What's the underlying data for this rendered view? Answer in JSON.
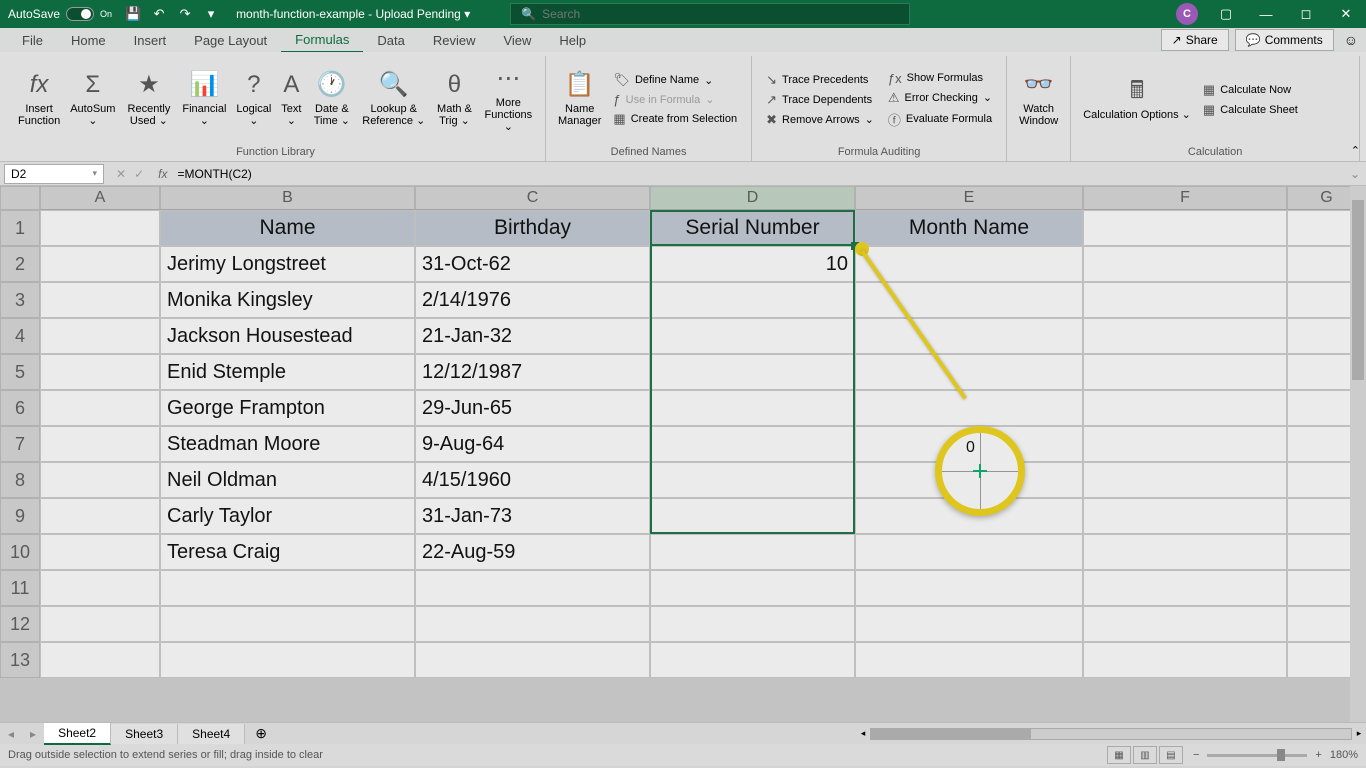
{
  "titlebar": {
    "autosave_label": "AutoSave",
    "autosave_state": "On",
    "filename": "month-function-example - Upload Pending",
    "search_placeholder": "Search",
    "avatar_initial": "C"
  },
  "tabs": {
    "file": "File",
    "home": "Home",
    "insert": "Insert",
    "pagelayout": "Page Layout",
    "formulas": "Formulas",
    "data": "Data",
    "review": "Review",
    "view": "View",
    "help": "Help",
    "share": "Share",
    "comments": "Comments"
  },
  "ribbon": {
    "insert_function": "Insert\nFunction",
    "autosum": "AutoSum",
    "recently_used": "Recently\nUsed",
    "financial": "Financial",
    "logical": "Logical",
    "text": "Text",
    "date_time": "Date &\nTime",
    "lookup_ref": "Lookup &\nReference",
    "math_trig": "Math &\nTrig",
    "more_functions": "More\nFunctions",
    "function_library": "Function Library",
    "name_manager": "Name\nManager",
    "define_name": "Define Name",
    "use_in_formula": "Use in Formula",
    "create_from_selection": "Create from Selection",
    "defined_names": "Defined Names",
    "trace_precedents": "Trace Precedents",
    "trace_dependents": "Trace Dependents",
    "remove_arrows": "Remove Arrows",
    "show_formulas": "Show Formulas",
    "error_checking": "Error Checking",
    "evaluate_formula": "Evaluate Formula",
    "formula_auditing": "Formula Auditing",
    "watch_window": "Watch\nWindow",
    "calculation_options": "Calculation\nOptions",
    "calculate_now": "Calculate Now",
    "calculate_sheet": "Calculate Sheet",
    "calculation": "Calculation"
  },
  "formulabar": {
    "cell_ref": "D2",
    "formula": "=MONTH(C2)"
  },
  "columns": [
    "A",
    "B",
    "C",
    "D",
    "E",
    "F",
    "G"
  ],
  "rows": [
    "1",
    "2",
    "3",
    "4",
    "5",
    "6",
    "7",
    "8",
    "9",
    "10",
    "11",
    "12",
    "13"
  ],
  "grid": {
    "headers": {
      "name": "Name",
      "birthday": "Birthday",
      "serial": "Serial Number",
      "month": "Month Name"
    },
    "data": [
      {
        "name": "Jerimy Longstreet",
        "birthday": "31-Oct-62",
        "serial": "10"
      },
      {
        "name": "Monika Kingsley",
        "birthday": "2/14/1976",
        "serial": ""
      },
      {
        "name": "Jackson Housestead",
        "birthday": "21-Jan-32",
        "serial": ""
      },
      {
        "name": "Enid Stemple",
        "birthday": "12/12/1987",
        "serial": ""
      },
      {
        "name": "George Frampton",
        "birthday": "29-Jun-65",
        "serial": ""
      },
      {
        "name": "Steadman Moore",
        "birthday": "9-Aug-64",
        "serial": ""
      },
      {
        "name": "Neil Oldman",
        "birthday": "4/15/1960",
        "serial": ""
      },
      {
        "name": "Carly Taylor",
        "birthday": "31-Jan-73",
        "serial": ""
      },
      {
        "name": "Teresa Craig",
        "birthday": "22-Aug-59",
        "serial": ""
      }
    ]
  },
  "callout_zoom": "0",
  "sheettabs": {
    "s2": "Sheet2",
    "s3": "Sheet3",
    "s4": "Sheet4"
  },
  "statusbar": {
    "msg": "Drag outside selection to extend series or fill; drag inside to clear",
    "zoom": "180%"
  }
}
